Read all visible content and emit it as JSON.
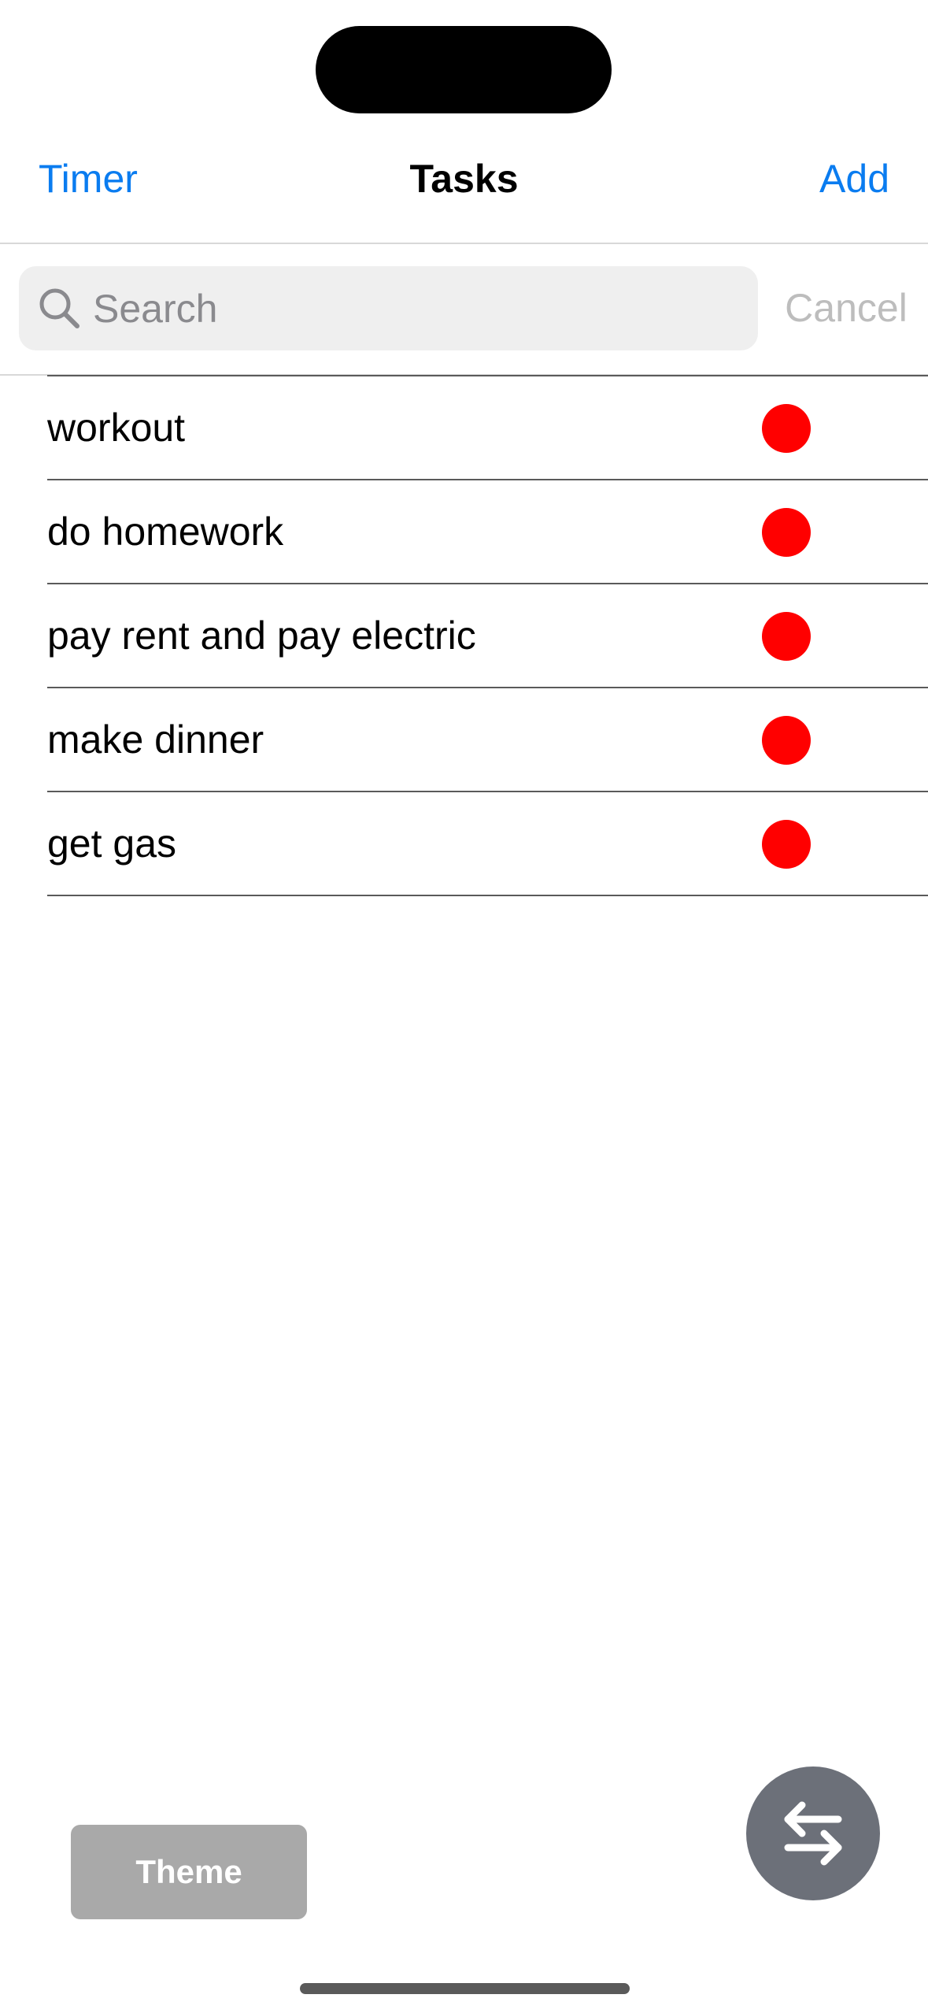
{
  "navbar": {
    "left_label": "Timer",
    "title": "Tasks",
    "right_label": "Add"
  },
  "search": {
    "placeholder": "Search",
    "value": "",
    "cancel_label": "Cancel"
  },
  "tasks": [
    {
      "label": "workout",
      "status_color": "#ff0000"
    },
    {
      "label": "do homework",
      "status_color": "#ff0000"
    },
    {
      "label": "pay rent and pay electric",
      "status_color": "#ff0000"
    },
    {
      "label": "make dinner",
      "status_color": "#ff0000"
    },
    {
      "label": "get gas",
      "status_color": "#ff0000"
    }
  ],
  "footer": {
    "theme_label": "Theme",
    "swap_icon": "arrows-left-right-icon"
  },
  "colors": {
    "accent": "#0a7cf0",
    "status_dot": "#ff0000",
    "theme_button": "#a9a9a9",
    "fab": "#6c7079"
  }
}
